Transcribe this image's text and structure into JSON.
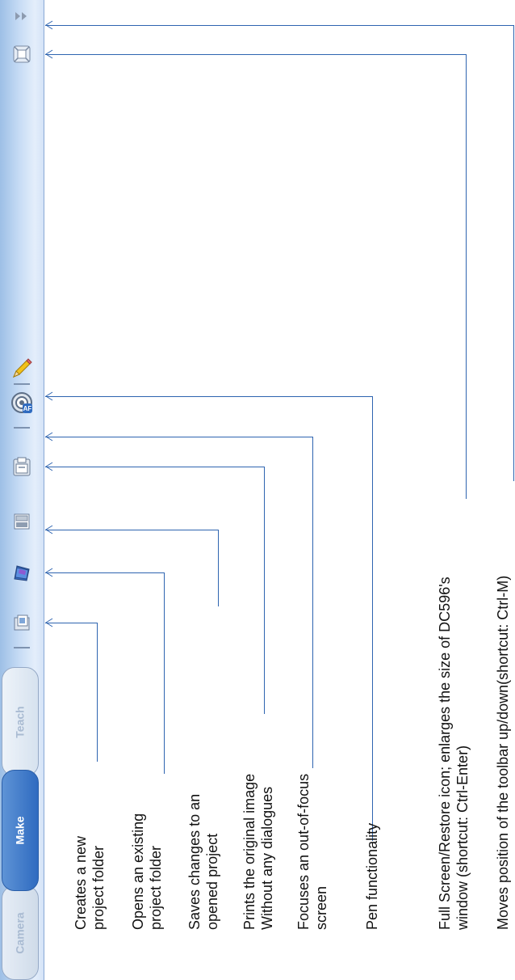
{
  "toolbar": {
    "tabs": [
      {
        "label": "Camera",
        "active": false
      },
      {
        "label": "Make",
        "active": true
      },
      {
        "label": "Teach",
        "active": false
      }
    ],
    "buttons": [
      {
        "icon": "new-project-icon"
      },
      {
        "icon": "open-project-icon"
      },
      {
        "icon": "save-project-icon"
      },
      {
        "icon": "print-icon"
      },
      {
        "icon": "autofocus-icon",
        "badge": "AF"
      },
      {
        "icon": "pen-icon"
      },
      {
        "icon": "fullscreen-icon"
      },
      {
        "icon": "move-toolbar-icon"
      }
    ],
    "accent_color": "#2f6bc0"
  },
  "captions": {
    "new_project": [
      "Creates a new",
      "project folder"
    ],
    "open_project": [
      "Opens an existing",
      "project folder"
    ],
    "save_project": [
      "Saves changes to an",
      "opened project"
    ],
    "print": [
      "Prints the original image",
      "Without any dialogues"
    ],
    "focus": [
      "Focuses an out-of-focus",
      "screen"
    ],
    "pen": [
      "Pen functionality"
    ],
    "fullscreen": [
      "Full Screen/Restore icon; enlarges the size of DC596's",
      "window (shortcut: Ctrl-Enter)"
    ],
    "move_toolbar": [
      "Moves position of the toolbar up/down(shortcut: Ctrl-M)"
    ]
  }
}
